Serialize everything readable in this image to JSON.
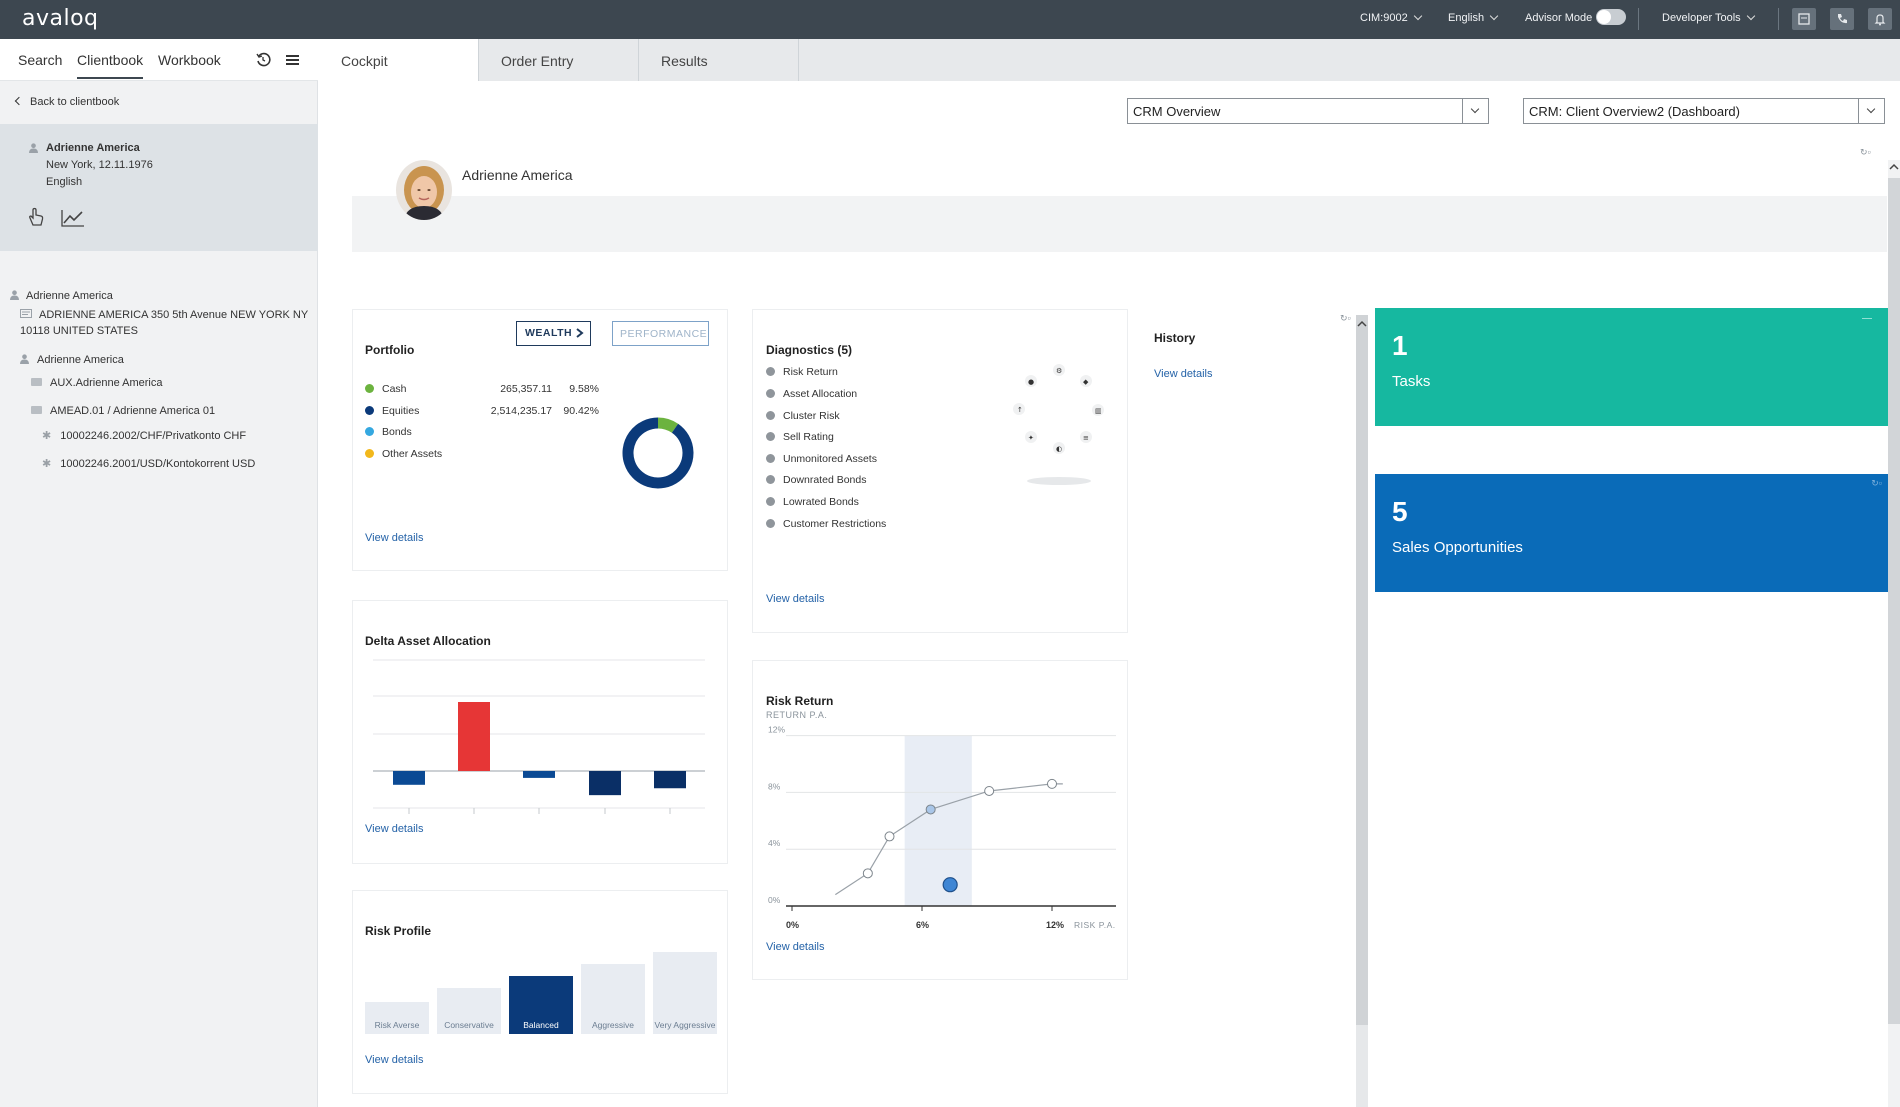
{
  "topbar": {
    "logo": "avaloq",
    "cim": "CIM:9002",
    "language": "English",
    "advisor_mode": "Advisor Mode",
    "dev_tools": "Developer Tools"
  },
  "left": {
    "tabs": [
      "Search",
      "Clientbook",
      "Workbook"
    ],
    "back": "Back to clientbook",
    "client": {
      "name": "Adrienne America",
      "birth": "New York, 12.11.1976",
      "language": "English"
    },
    "tree": {
      "root": "Adrienne America",
      "address_line1": "ADRIENNE AMERICA 350 5th Avenue NEW YORK NY",
      "address_line2": "10118 UNITED STATES",
      "person": "Adrienne America",
      "folder1": "AUX.Adrienne America",
      "folder2": "AMEAD.01 / Adrienne America 01",
      "account1": "10002246.2002/CHF/Privatkonto CHF",
      "account2": "10002246.2001/USD/Kontokorrent USD"
    }
  },
  "main_tabs": [
    "Cockpit",
    "Order Entry",
    "Results"
  ],
  "dropdowns": {
    "overview": "CRM Overview",
    "dashboard": "CRM: Client Overview2 (Dashboard)"
  },
  "client_header": {
    "name": "Adrienne America"
  },
  "portfolio": {
    "title": "Portfolio",
    "wealth_btn": "WEALTH",
    "performance_btn": "PERFORMANCE",
    "rows": [
      {
        "label": "Cash",
        "amount": "265,357.11",
        "pct": "9.58%",
        "color": "#6cb33f"
      },
      {
        "label": "Equities",
        "amount": "2,514,235.17",
        "pct": "90.42%",
        "color": "#0b3a7a"
      },
      {
        "label": "Bonds",
        "amount": "",
        "pct": "",
        "color": "#35a8e0"
      },
      {
        "label": "Other Assets",
        "amount": "",
        "pct": "",
        "color": "#f2b81c"
      }
    ],
    "view": "View details"
  },
  "diagnostics": {
    "title": "Diagnostics (5)",
    "items": [
      "Risk Return",
      "Asset Allocation",
      "Cluster Risk",
      "Sell Rating",
      "Unmonitored Assets",
      "Downrated Bonds",
      "Lowrated Bonds",
      "Customer Restrictions"
    ],
    "view": "View details"
  },
  "history": {
    "title": "History",
    "view": "View details"
  },
  "delta": {
    "title": "Delta Asset Allocation",
    "view": "View details"
  },
  "risk_return": {
    "title": "Risk Return",
    "ylabel": "RETURN P.A.",
    "yticks": [
      "12%",
      "8%",
      "4%",
      "0%"
    ],
    "xticks": [
      "0%",
      "6%",
      "12%"
    ],
    "xlabel": "RISK P.A.",
    "view": "View details"
  },
  "risk_profile": {
    "title": "Risk Profile",
    "levels": [
      "Risk Averse",
      "Conservative",
      "Balanced",
      "Aggressive",
      "Very Aggressive"
    ],
    "selected": "Balanced",
    "view": "View details"
  },
  "tiles": [
    {
      "count": "1",
      "label": "Tasks",
      "color": "#16b8a0"
    },
    {
      "count": "5",
      "label": "Sales Opportunities",
      "color": "#0a6bb8"
    }
  ],
  "chart_data": [
    {
      "type": "pie",
      "labels": [
        "Cash",
        "Equities"
      ],
      "values": [
        9.58,
        90.42
      ]
    },
    {
      "type": "bar",
      "title": "Delta Asset Allocation",
      "categories": [
        "1",
        "2",
        "3",
        "4",
        "5"
      ],
      "values": [
        -2,
        10,
        -1,
        -3.5,
        -2.5
      ]
    },
    {
      "type": "scatter",
      "title": "Risk Return",
      "xlabel": "RISK P.A.",
      "ylabel": "RETURN P.A.",
      "xlim": [
        0,
        12.5
      ],
      "ylim": [
        0,
        12
      ],
      "series": [
        {
          "points": [
            [
              3.5,
              2.3
            ],
            [
              4.5,
              4.9
            ],
            [
              6.4,
              6.8
            ],
            [
              9.1,
              8.1
            ],
            [
              12,
              8.6
            ]
          ]
        },
        {
          "points": [
            [
              7.3,
              1.5
            ]
          ]
        }
      ]
    }
  ]
}
